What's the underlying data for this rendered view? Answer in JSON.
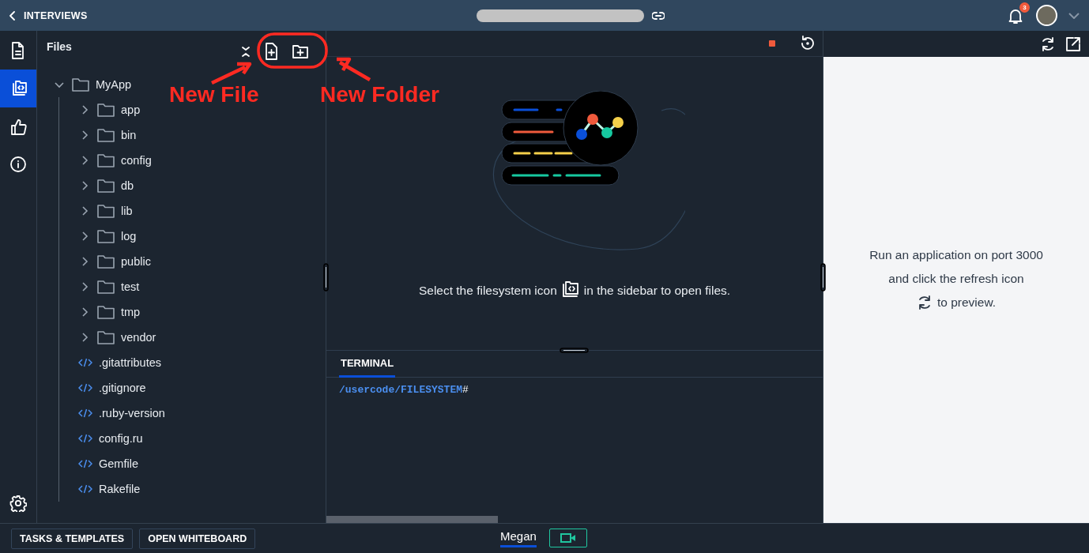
{
  "top_bar": {
    "back_label": "INTERVIEWS",
    "notification_count": "3"
  },
  "rail": {
    "items": [
      {
        "kind": "document",
        "selected": false
      },
      {
        "kind": "filesystem",
        "selected": true
      },
      {
        "kind": "thumbs-up",
        "selected": false
      },
      {
        "kind": "info",
        "selected": false
      }
    ]
  },
  "files_panel": {
    "title": "Files",
    "tree": [
      {
        "kind": "folder",
        "label": "MyApp",
        "expanded": true,
        "children": [
          {
            "kind": "folder",
            "label": "app",
            "expanded": false
          },
          {
            "kind": "folder",
            "label": "bin",
            "expanded": false
          },
          {
            "kind": "folder",
            "label": "config",
            "expanded": false
          },
          {
            "kind": "folder",
            "label": "db",
            "expanded": false
          },
          {
            "kind": "folder",
            "label": "lib",
            "expanded": false
          },
          {
            "kind": "folder",
            "label": "log",
            "expanded": false
          },
          {
            "kind": "folder",
            "label": "public",
            "expanded": false
          },
          {
            "kind": "folder",
            "label": "test",
            "expanded": false
          },
          {
            "kind": "folder",
            "label": "tmp",
            "expanded": false
          },
          {
            "kind": "folder",
            "label": "vendor",
            "expanded": false
          },
          {
            "kind": "file",
            "label": ".gitattributes"
          },
          {
            "kind": "file",
            "label": ".gitignore"
          },
          {
            "kind": "file",
            "label": ".ruby-version"
          },
          {
            "kind": "file",
            "label": "config.ru"
          },
          {
            "kind": "file",
            "label": "Gemfile"
          },
          {
            "kind": "file",
            "label": "Rakefile"
          }
        ]
      }
    ]
  },
  "annotations": [
    {
      "label": "New File"
    },
    {
      "label": "New Folder"
    }
  ],
  "editor": {
    "message_before": "Select the filesystem icon",
    "message_after": "in the sidebar to open files."
  },
  "terminal": {
    "tabs": [
      {
        "label": "TERMINAL",
        "selected": true
      }
    ],
    "prompt_path": "/usercode/FILESYSTEM",
    "prompt_symbol": "#"
  },
  "preview": {
    "message_before": "Run an application on port 3000 and click the refresh icon",
    "message_after": "to preview."
  },
  "bottom_bar": {
    "buttons": [
      "TASKS & TEMPLATES",
      "OPEN WHITEBOARD"
    ],
    "participants": [
      {
        "name": "Megan",
        "selected": true
      }
    ]
  }
}
